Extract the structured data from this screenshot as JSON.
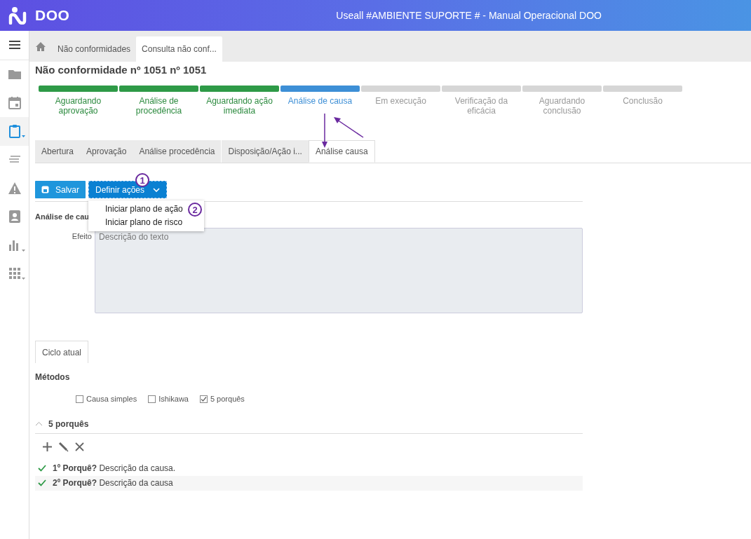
{
  "app": {
    "logo_text": "DOO",
    "title": "Useall #AMBIENTE SUPORTE # - Manual Operacional DOO"
  },
  "sidebar": [
    {
      "kind": "menu",
      "selected": false,
      "expandable": false
    },
    {
      "kind": "folder",
      "selected": false,
      "expandable": false
    },
    {
      "kind": "calendar",
      "selected": false,
      "expandable": false
    },
    {
      "kind": "clipboard",
      "selected": true,
      "expandable": true
    },
    {
      "kind": "lines",
      "selected": false,
      "expandable": false
    },
    {
      "kind": "warning",
      "selected": false,
      "expandable": false
    },
    {
      "kind": "contact",
      "selected": false,
      "expandable": false
    },
    {
      "kind": "chart",
      "selected": false,
      "expandable": true
    },
    {
      "kind": "grid",
      "selected": false,
      "expandable": true
    }
  ],
  "breadcrumbs": [
    {
      "label": "Não conformidades",
      "selected": false
    },
    {
      "label": "Consulta não conf...",
      "selected": true
    }
  ],
  "page_title": "Não conformidade nº 1051 nº 1051",
  "steps": [
    {
      "label": "Aguardando aprovação",
      "completed": true,
      "selected": false
    },
    {
      "label": "Análise de procedência",
      "completed": true,
      "selected": false
    },
    {
      "label": "Aguardando ação imediata",
      "completed": true,
      "selected": false
    },
    {
      "label": "Análise de causa",
      "completed": false,
      "selected": true
    },
    {
      "label": "Em execução",
      "completed": false,
      "selected": false
    },
    {
      "label": "Verificação da eficácia",
      "completed": false,
      "selected": false
    },
    {
      "label": "Aguardando conclusão",
      "completed": false,
      "selected": false
    },
    {
      "label": "Conclusão",
      "completed": false,
      "selected": false
    }
  ],
  "tabs": [
    {
      "label": "Abertura",
      "selected": false
    },
    {
      "label": "Aprovação",
      "selected": false
    },
    {
      "label": "Análise procedência",
      "selected": false
    },
    {
      "label": "Disposição/Ação i...",
      "selected": false
    },
    {
      "label": "Análise causa",
      "selected": true
    }
  ],
  "toolbar": {
    "save_label": "Salvar",
    "actions_label": "Definir ações",
    "menu": [
      "Iniciar plano de ação",
      "Iniciar plano de risco"
    ]
  },
  "callouts": [
    "1",
    "2"
  ],
  "section_title": "Análise de cau",
  "effect": {
    "label": "Efeito",
    "placeholder": "Descrição do texto"
  },
  "cycle_tabs": [
    {
      "label": "Ciclo atual",
      "selected": true
    }
  ],
  "methods": {
    "title": "Métodos",
    "options": [
      {
        "label": "Causa simples",
        "checked": false
      },
      {
        "label": "Ishikawa",
        "checked": false
      },
      {
        "label": "5 porquês",
        "checked": true
      }
    ]
  },
  "five_whys": {
    "title": "5 porquês",
    "expanded": true,
    "items": [
      {
        "text": "**1º Porquê?** Descrição da causa.",
        "done": true
      },
      {
        "text": "**2º Porquê?** Descrição da causa",
        "done": true
      }
    ]
  }
}
